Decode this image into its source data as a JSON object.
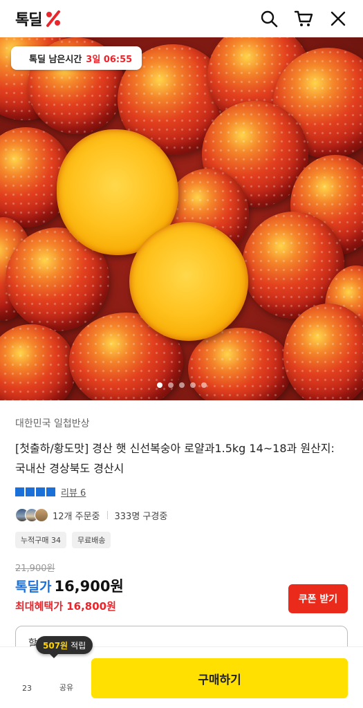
{
  "header": {
    "logo_text": "톡딜",
    "icons": [
      "search-icon",
      "cart-icon",
      "close-icon"
    ]
  },
  "hero": {
    "timer_label": "톡딜 남은시간",
    "timer_value": "3일 06:55",
    "carousel_count": 5,
    "carousel_active": 1
  },
  "product": {
    "store": "대한민국 일첩반상",
    "title": "[첫출하/황도맛] 경산 햇 신선복숭아 로얄과1.5kg 14~18과 원산지: 국내산 경상북도 경산시",
    "rating_stars": 4,
    "review_label": "리뷰 6",
    "orders": "12개 주문중",
    "viewers": "333명 구경중",
    "tags": [
      "누적구매 34",
      "무료배송"
    ]
  },
  "price": {
    "original": "21,900원",
    "deal_label": "톡딜가",
    "deal_value": "16,900원",
    "max_benefit": "최대혜택가 16,800원",
    "coupon_button": "쿠폰 받기"
  },
  "options_peek": "할",
  "points": {
    "amount": "507원",
    "label": "적립"
  },
  "bottom": {
    "like_count": "23",
    "share_label": "공유",
    "buy_button": "구매하기"
  },
  "colors": {
    "brand_blue": "#1a6fd8",
    "brand_red": "#e8262c",
    "buy_yellow": "#ffe000",
    "coupon_red": "#ea2b1c"
  }
}
